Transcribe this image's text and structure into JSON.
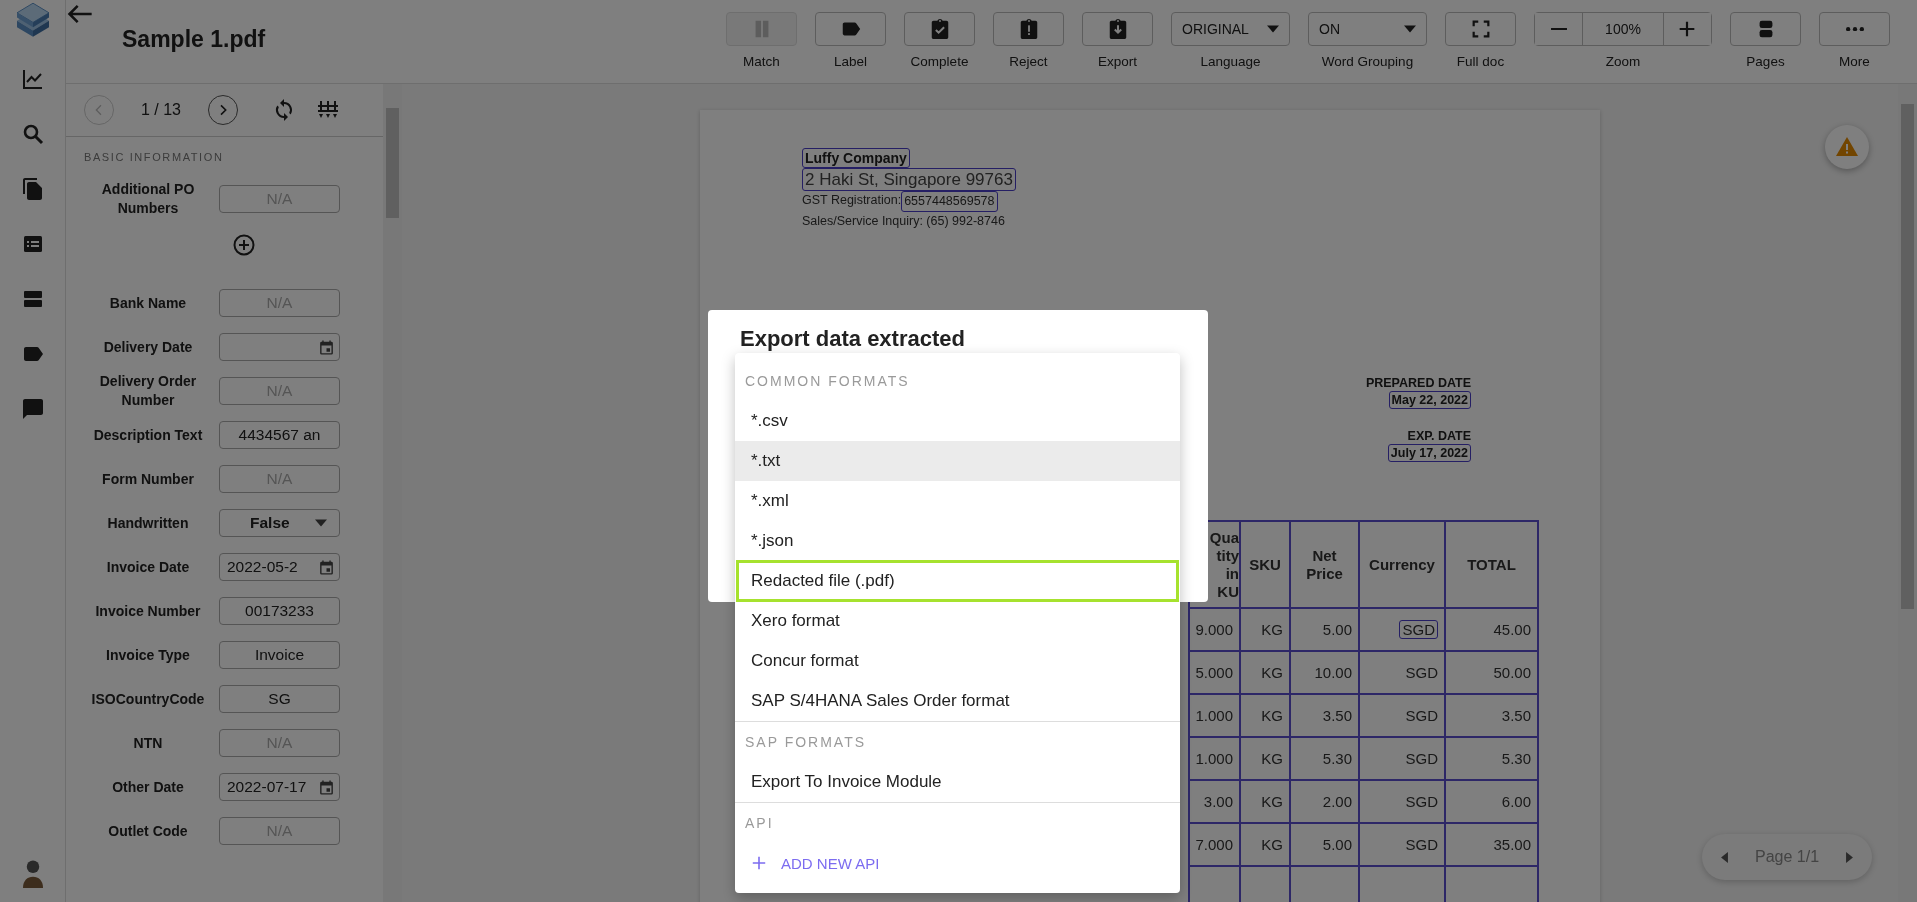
{
  "header": {
    "title": "Sample 1.pdf",
    "toolbar": [
      {
        "kind": "button",
        "label": "Match",
        "disabled": true
      },
      {
        "kind": "button",
        "label": "Label",
        "disabled": false
      },
      {
        "kind": "button",
        "label": "Complete",
        "disabled": false
      },
      {
        "kind": "button",
        "label": "Reject",
        "disabled": false
      },
      {
        "kind": "button",
        "label": "Export",
        "disabled": false
      },
      {
        "kind": "dropdown",
        "label": "Language",
        "value": "ORIGINAL",
        "disabled": false
      },
      {
        "kind": "dropdown",
        "label": "Word Grouping",
        "value": "ON",
        "disabled": false
      },
      {
        "kind": "button",
        "label": "Full doc",
        "disabled": false
      },
      {
        "kind": "zoom",
        "label": "Zoom",
        "value": "100%",
        "disabled": false
      },
      {
        "kind": "button",
        "label": "Pages",
        "disabled": false
      },
      {
        "kind": "button",
        "label": "More",
        "disabled": false
      }
    ]
  },
  "panel": {
    "pager": {
      "page": "1 / 13",
      "prev_disabled": true
    },
    "section": "BASIC INFORMATION",
    "fields": [
      {
        "kind": "text",
        "label": "Additional PO Numbers",
        "placeholder": "N/A"
      },
      {
        "kind": "add"
      },
      {
        "kind": "text",
        "label": "Bank Name",
        "placeholder": "N/A"
      },
      {
        "kind": "date",
        "label": "Delivery Date"
      },
      {
        "kind": "text",
        "label": "Delivery Order Number",
        "placeholder": "N/A"
      },
      {
        "kind": "text",
        "label": "Description Text",
        "value": "4434567 an"
      },
      {
        "kind": "text",
        "label": "Form Number",
        "placeholder": "N/A"
      },
      {
        "kind": "select",
        "label": "Handwritten",
        "value": "False"
      },
      {
        "kind": "date",
        "label": "Invoice Date",
        "value": "2022-05-2"
      },
      {
        "kind": "text",
        "label": "Invoice Number",
        "value": "00173233"
      },
      {
        "kind": "text",
        "label": "Invoice Type",
        "value": "Invoice"
      },
      {
        "kind": "text",
        "label": "ISOCountryCode",
        "value": "SG"
      },
      {
        "kind": "text",
        "label": "NTN",
        "placeholder": "N/A"
      },
      {
        "kind": "date",
        "label": "Other Date",
        "value": "2022-07-17"
      },
      {
        "kind": "text",
        "label": "Outlet Code",
        "placeholder": "N/A"
      }
    ]
  },
  "document": {
    "company": [
      {
        "kind": "bold",
        "segments": [
          {
            "text": "Luffy Company",
            "boxed": true
          }
        ]
      },
      {
        "kind": "large",
        "segments": [
          {
            "text": "2 Haki St, Singapore 99763",
            "boxed": true
          }
        ]
      },
      {
        "kind": "small",
        "segments": [
          {
            "text": "GST Registration:",
            "boxed": false
          },
          {
            "text": "6557448569578",
            "boxed": true
          }
        ]
      },
      {
        "kind": "small",
        "segments": [
          {
            "text": "Sales/Service Inquiry: (65) 992-8746",
            "boxed": false
          }
        ]
      }
    ],
    "dates": [
      {
        "label": "PREPARED DATE",
        "value": "May 22, 2022"
      },
      {
        "label": "EXP. DATE",
        "value": "July 17, 2022"
      }
    ],
    "table": {
      "columns": [
        {
          "lines": [
            "Qua",
            "tity",
            "in",
            "KU"
          ]
        },
        {
          "lines": [
            "SKU"
          ]
        },
        {
          "lines": [
            "Net",
            "Price"
          ]
        },
        {
          "lines": [
            "Currency"
          ]
        },
        {
          "lines": [
            "TOTAL"
          ]
        }
      ],
      "rows": [
        {
          "cells": [
            "9.000",
            "KG",
            "5.00",
            "SGD",
            "45.00"
          ],
          "currency_boxed": true
        },
        {
          "cells": [
            "5.000",
            "KG",
            "10.00",
            "SGD",
            "50.00"
          ],
          "currency_boxed": false
        },
        {
          "cells": [
            "1.000",
            "KG",
            "3.50",
            "SGD",
            "3.50"
          ],
          "currency_boxed": false
        },
        {
          "cells": [
            "1.000",
            "KG",
            "5.30",
            "SGD",
            "5.30"
          ],
          "currency_boxed": false
        },
        {
          "cells": [
            "3.00",
            "KG",
            "2.00",
            "SGD",
            "6.00"
          ],
          "currency_boxed": false
        },
        {
          "cells": [
            "7.000",
            "KG",
            "5.00",
            "SGD",
            "35.00"
          ],
          "currency_boxed": false
        }
      ]
    }
  },
  "page_nav": {
    "label": "Page 1/1"
  },
  "modal": {
    "title": "Export data extracted",
    "sections": [
      {
        "title": "COMMON FORMATS",
        "options": [
          {
            "kind": "option",
            "label": "*.csv",
            "hovered": false,
            "focused": false
          },
          {
            "kind": "option",
            "label": "*.txt",
            "hovered": true,
            "focused": false
          },
          {
            "kind": "option",
            "label": "*.xml",
            "hovered": false,
            "focused": false
          },
          {
            "kind": "option",
            "label": "*.json",
            "hovered": false,
            "focused": false
          },
          {
            "kind": "option",
            "label": "Redacted file (.pdf)",
            "hovered": false,
            "focused": true
          },
          {
            "kind": "option",
            "label": "Xero format",
            "hovered": false,
            "focused": false
          },
          {
            "kind": "option",
            "label": "Concur format",
            "hovered": false,
            "focused": false
          },
          {
            "kind": "option",
            "label": "SAP S/4HANA Sales Order format",
            "hovered": false,
            "focused": false
          }
        ]
      },
      {
        "title": "SAP FORMATS",
        "options": [
          {
            "kind": "option",
            "label": "Export To Invoice Module",
            "hovered": false,
            "focused": false
          }
        ]
      },
      {
        "title": "API",
        "options": [
          {
            "kind": "add",
            "label": "ADD NEW API",
            "hovered": false,
            "focused": false
          }
        ]
      }
    ]
  }
}
